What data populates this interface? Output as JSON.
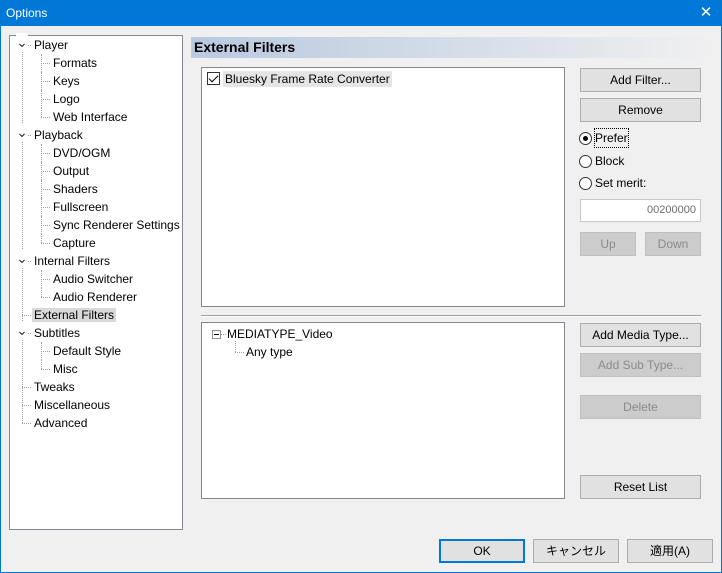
{
  "window": {
    "title": "Options",
    "close_glyph": "✕"
  },
  "tree": {
    "items": [
      {
        "label": "Player",
        "level": 0,
        "expanded": true
      },
      {
        "label": "Formats",
        "level": 1
      },
      {
        "label": "Keys",
        "level": 1
      },
      {
        "label": "Logo",
        "level": 1
      },
      {
        "label": "Web Interface",
        "level": 1
      },
      {
        "label": "Playback",
        "level": 0,
        "expanded": true
      },
      {
        "label": "DVD/OGM",
        "level": 1
      },
      {
        "label": "Output",
        "level": 1
      },
      {
        "label": "Shaders",
        "level": 1
      },
      {
        "label": "Fullscreen",
        "level": 1
      },
      {
        "label": "Sync Renderer Settings",
        "level": 1
      },
      {
        "label": "Capture",
        "level": 1
      },
      {
        "label": "Internal Filters",
        "level": 0,
        "expanded": true
      },
      {
        "label": "Audio Switcher",
        "level": 1
      },
      {
        "label": "Audio Renderer",
        "level": 1
      },
      {
        "label": "External Filters",
        "level": 0,
        "selected": true
      },
      {
        "label": "Subtitles",
        "level": 0,
        "expanded": true
      },
      {
        "label": "Default Style",
        "level": 1
      },
      {
        "label": "Misc",
        "level": 1
      },
      {
        "label": "Tweaks",
        "level": 0
      },
      {
        "label": "Miscellaneous",
        "level": 0
      },
      {
        "label": "Advanced",
        "level": 0
      }
    ]
  },
  "page": {
    "title": "External Filters",
    "filters": [
      {
        "label": "Bluesky Frame Rate Converter",
        "checked": true
      }
    ],
    "buttons": {
      "add_filter": "Add Filter...",
      "remove": "Remove",
      "up": "Up",
      "down": "Down",
      "add_media_type": "Add Media Type...",
      "add_sub_type": "Add Sub Type...",
      "delete": "Delete",
      "reset_list": "Reset List"
    },
    "merit_options": {
      "prefer": "Prefer",
      "block": "Block",
      "set_merit": "Set merit:",
      "selected": "prefer"
    },
    "merit_value": "00200000",
    "media_types": {
      "type": "MEDIATYPE_Video",
      "subtype": "Any type"
    }
  },
  "dialog_buttons": {
    "ok": "OK",
    "cancel": "キャンセル",
    "apply": "適用(A)"
  }
}
